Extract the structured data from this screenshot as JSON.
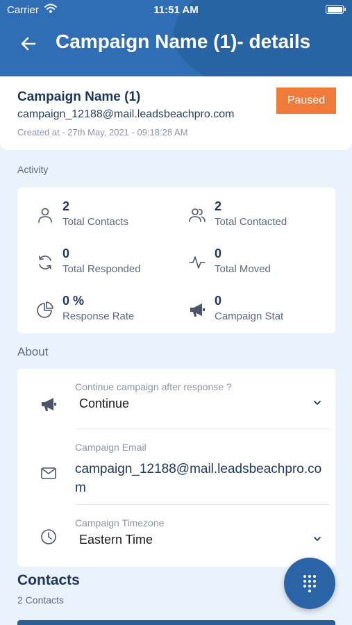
{
  "status_bar": {
    "carrier": "Carrier",
    "time": "11:51 AM"
  },
  "header": {
    "title": "Campaign Name (1)- details"
  },
  "campaign": {
    "name": "Campaign Name (1)",
    "email": "campaign_12188@mail.leadsbeachpro.com",
    "created": "Created at - 27th May, 2021 - 09:18:28 AM",
    "status": "Paused"
  },
  "activity": {
    "label": "Activity",
    "stats": [
      {
        "value": "2",
        "label": "Total Contacts",
        "icon": "user-icon"
      },
      {
        "value": "2",
        "label": "Total Contacted",
        "icon": "users-icon"
      },
      {
        "value": "0",
        "label": "Total Responded",
        "icon": "refresh-icon"
      },
      {
        "value": "0",
        "label": "Total Moved",
        "icon": "activity-icon"
      },
      {
        "value": "0 %",
        "label": "Response Rate",
        "icon": "pie-chart-icon"
      },
      {
        "value": "0",
        "label": "Campaign Stat",
        "icon": "megaphone-icon"
      }
    ]
  },
  "about": {
    "label": "About",
    "continue_label": "Continue campaign after response ?",
    "continue_value": "Continue",
    "email_label": "Campaign Email",
    "email_value": "campaign_12188@mail.leadsbeachpro.com",
    "timezone_label": "Campaign Timezone",
    "timezone_value": "Eastern Time"
  },
  "contacts": {
    "title": "Contacts",
    "count": "2 Contacts"
  },
  "colors": {
    "header": "#2f6db4",
    "badge": "#f07a3a",
    "background": "#eaf2fb",
    "fab": "#2b64a6"
  }
}
